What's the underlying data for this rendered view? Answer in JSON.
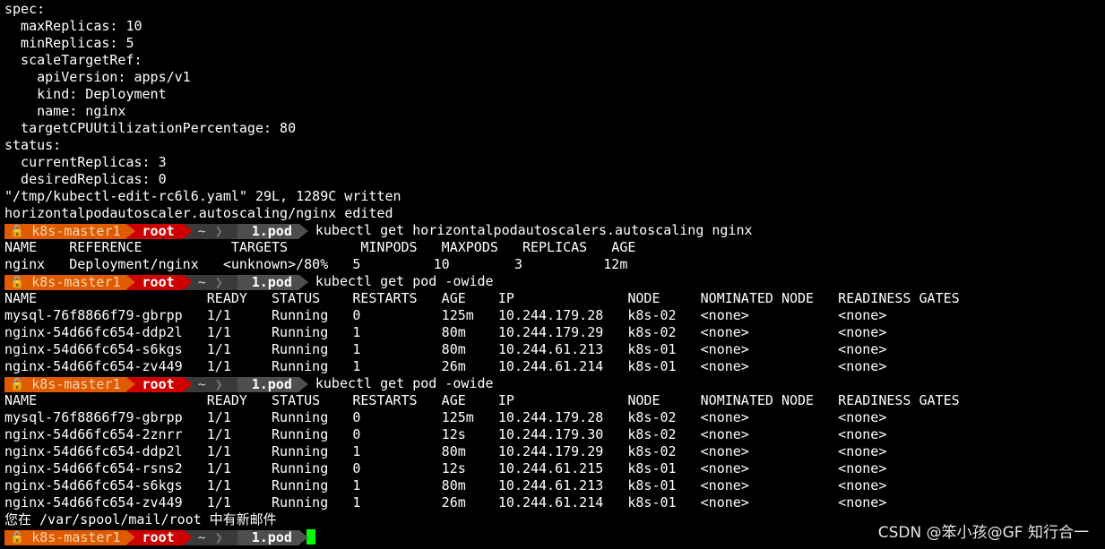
{
  "prompt": {
    "host": "k8s-master1",
    "user": "root",
    "dir": "~",
    "path": "1.pod",
    "lock_icon": "lock-icon"
  },
  "output_lines": [
    "spec:",
    "  maxReplicas: 10",
    "  minReplicas: 5",
    "  scaleTargetRef:",
    "    apiVersion: apps/v1",
    "    kind: Deployment",
    "    name: nginx",
    "  targetCPUUtilizationPercentage: 80",
    "status:",
    "  currentReplicas: 3",
    "  desiredReplicas: 0",
    "\"/tmp/kubectl-edit-rc6l6.yaml\" 29L, 1289C written",
    "horizontalpodautoscaler.autoscaling/nginx edited"
  ],
  "block1": {
    "command": "kubectl get horizontalpodautoscalers.autoscaling nginx",
    "lines": [
      "NAME    REFERENCE           TARGETS         MINPODS   MAXPODS   REPLICAS   AGE",
      "nginx   Deployment/nginx   <unknown>/80%   5         10        3          12m"
    ]
  },
  "block2": {
    "command": "kubectl get pod -owide",
    "lines": [
      "NAME                     READY   STATUS    RESTARTS   AGE    IP              NODE     NOMINATED NODE   READINESS GATES",
      "mysql-76f8866f79-gbrpp   1/1     Running   0          125m   10.244.179.28   k8s-02   <none>           <none>",
      "nginx-54d66fc654-ddp2l   1/1     Running   1          80m    10.244.179.29   k8s-02   <none>           <none>",
      "nginx-54d66fc654-s6kgs   1/1     Running   1          80m    10.244.61.213   k8s-01   <none>           <none>",
      "nginx-54d66fc654-zv449   1/1     Running   1          26m    10.244.61.214   k8s-01   <none>           <none>"
    ]
  },
  "block3": {
    "command": "kubectl get pod -owide",
    "lines": [
      "NAME                     READY   STATUS    RESTARTS   AGE    IP              NODE     NOMINATED NODE   READINESS GATES",
      "mysql-76f8866f79-gbrpp   1/1     Running   0          125m   10.244.179.28   k8s-02   <none>           <none>",
      "nginx-54d66fc654-2znrr   1/1     Running   0          12s    10.244.179.30   k8s-02   <none>           <none>",
      "nginx-54d66fc654-ddp2l   1/1     Running   1          80m    10.244.179.29   k8s-02   <none>           <none>",
      "nginx-54d66fc654-rsns2   1/1     Running   0          12s    10.244.61.215   k8s-01   <none>           <none>",
      "nginx-54d66fc654-s6kgs   1/1     Running   1          80m    10.244.61.213   k8s-01   <none>           <none>",
      "nginx-54d66fc654-zv449   1/1     Running   1          26m    10.244.61.214   k8s-01   <none>           <none>"
    ],
    "mail_notice": "您在 /var/spool/mail/root 中有新邮件"
  },
  "watermark": "CSDN @笨小孩@GF 知行合一",
  "colors": {
    "background": "#000000",
    "host_segment": "#e05a00",
    "user_segment": "#cc0000",
    "cursor": "#00ff00"
  }
}
